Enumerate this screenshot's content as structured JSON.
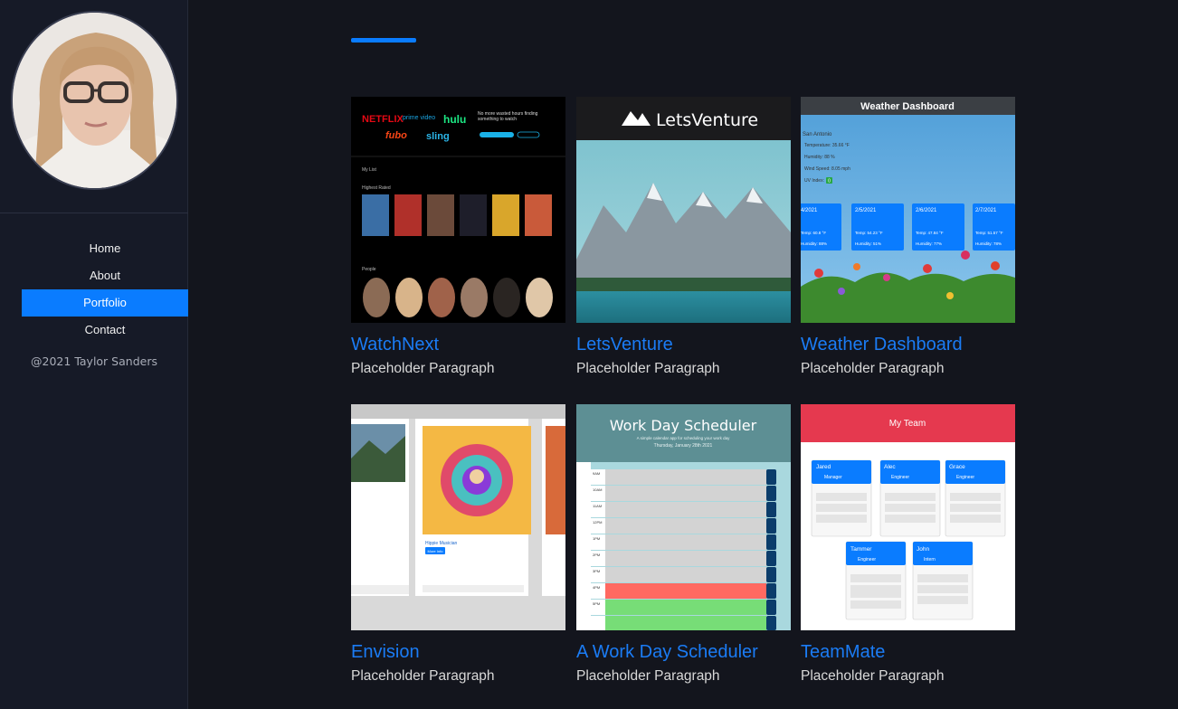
{
  "sidebar": {
    "nav": [
      {
        "label": "Home",
        "active": false
      },
      {
        "label": "About",
        "active": false
      },
      {
        "label": "Portfolio",
        "active": true
      },
      {
        "label": "Contact",
        "active": false
      }
    ],
    "copyright": "@2021 Taylor Sanders"
  },
  "projects": [
    {
      "title": "WatchNext",
      "description": "Placeholder Paragraph"
    },
    {
      "title": "LetsVenture",
      "description": "Placeholder Paragraph"
    },
    {
      "title": "Weather Dashboard",
      "description": "Placeholder Paragraph"
    },
    {
      "title": "Envision",
      "description": "Placeholder Paragraph"
    },
    {
      "title": "A Work Day Scheduler",
      "description": "Placeholder Paragraph"
    },
    {
      "title": "TeamMate",
      "description": "Placeholder Paragraph"
    }
  ],
  "thumbs": {
    "watchnext": {
      "logos": [
        "NETFLIX",
        "prime video",
        "hulu",
        "fubo",
        "sling"
      ],
      "tagline": "No more wasted hours finding something to watch",
      "sections": [
        "My List",
        "Highest Rated",
        "People"
      ]
    },
    "letsventure": {
      "brand": "LetsVenture"
    },
    "weather": {
      "header": "Weather Dashboard",
      "city": "San Antonio",
      "stats": [
        "Temperature: 35.66 °F",
        "Humidity: 88 %",
        "Wind Speed: 8.05 mph",
        "UV Index:"
      ],
      "uv": "0",
      "days": [
        {
          "date": "4/2021",
          "temp": "Temp: 60.8 °F",
          "hum": "Humidity: 88%"
        },
        {
          "date": "2/5/2021",
          "temp": "Temp: 54.23 °F",
          "hum": "Humidity: 51%"
        },
        {
          "date": "2/6/2021",
          "temp": "Temp: 47.84 °F",
          "hum": "Humidity: 77%"
        },
        {
          "date": "2/7/2021",
          "temp": "Temp: 51.57 °F",
          "hum": "Humidity: 78%"
        }
      ]
    },
    "envision": {
      "caption": "Hippie Musician",
      "button": "More Info"
    },
    "scheduler": {
      "header": "Work Day Scheduler",
      "sub": "A simple calendar app for scheduling your work day",
      "date": "Thursday, January 28th 2021",
      "hours": [
        "9AM",
        "10AM",
        "11AM",
        "12PM",
        "1PM",
        "2PM",
        "3PM",
        "4PM",
        "5PM"
      ]
    },
    "teammate": {
      "header": "My Team",
      "members": [
        {
          "name": "Jared",
          "role": "Manager"
        },
        {
          "name": "Alec",
          "role": "Engineer"
        },
        {
          "name": "Grace",
          "role": "Engineer"
        },
        {
          "name": "Tammer",
          "role": "Engineer"
        },
        {
          "name": "John",
          "role": "Intern"
        }
      ]
    }
  },
  "colors": {
    "accent": "#0a7cff",
    "link": "#1b7cf5",
    "background": "#13151d",
    "sidebar": "#161a27"
  }
}
